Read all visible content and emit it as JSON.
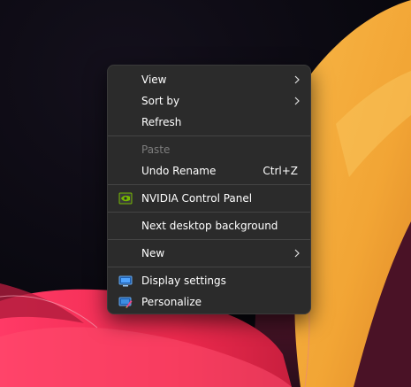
{
  "context_menu": {
    "view_label": "View",
    "sort_by_label": "Sort by",
    "refresh_label": "Refresh",
    "paste_label": "Paste",
    "undo_rename_label": "Undo Rename",
    "undo_rename_shortcut": "Ctrl+Z",
    "nvidia_label": "NVIDIA Control Panel",
    "next_background_label": "Next desktop background",
    "new_label": "New",
    "display_settings_label": "Display settings",
    "personalize_label": "Personalize"
  },
  "icons": {
    "chevron": "chevron-right-icon",
    "nvidia": "nvidia-icon",
    "display": "display-settings-icon",
    "personalize": "personalize-icon"
  },
  "colors": {
    "menu_background": "#2b2b2b",
    "menu_text": "#ffffff",
    "disabled_text": "#7d7d7d",
    "separator": "#444444",
    "wallpaper_orange": "#f2a535",
    "wallpaper_red": "#e8284e"
  }
}
